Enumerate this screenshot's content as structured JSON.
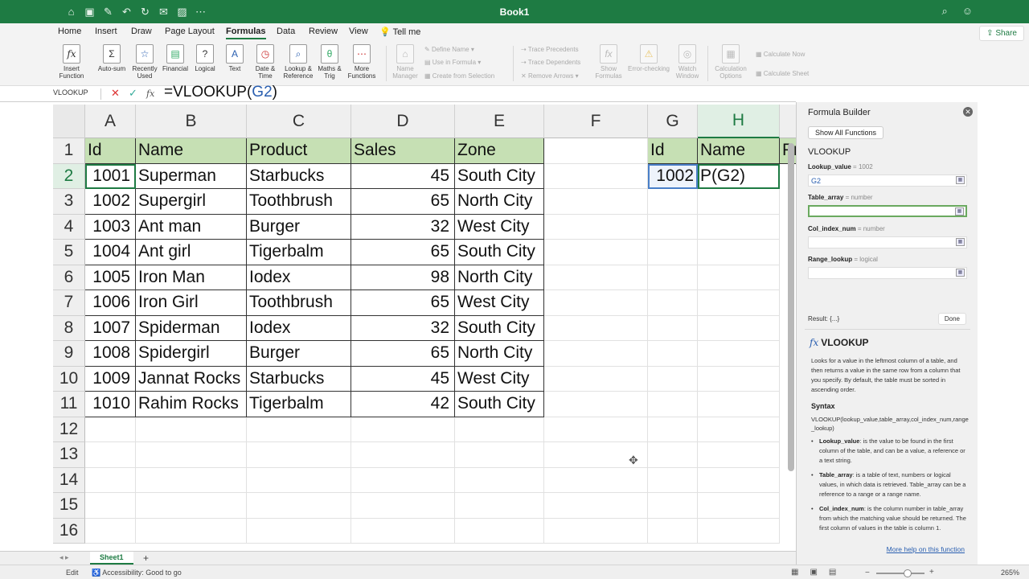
{
  "window": {
    "title": "Book1"
  },
  "quick_access": [
    "home-icon",
    "save-icon",
    "edit-icon",
    "undo-icon",
    "redo-icon",
    "mail-icon",
    "image-icon",
    "more-icon"
  ],
  "tabs": [
    "Home",
    "Insert",
    "Draw",
    "Page Layout",
    "Formulas",
    "Data",
    "Review",
    "View",
    "Tell me"
  ],
  "active_tab": "Formulas",
  "share_label": "Share",
  "ribbon": {
    "insert_function": "Insert Function",
    "autosum": "Auto-sum",
    "recently_used": "Recently Used",
    "financial": "Financial",
    "logical": "Logical",
    "text": "Text",
    "date_time": "Date & Time",
    "lookup": "Lookup & Reference",
    "maths": "Maths & Trig",
    "more_functions": "More Functions",
    "name_manager": "Name Manager",
    "define_name": "Define Name",
    "use_in_formula": "Use in Formula",
    "create_from_selection": "Create from Selection",
    "trace_precedents": "Trace Precedents",
    "trace_dependents": "Trace Dependents",
    "remove_arrows": "Remove Arrows",
    "show_formulas": "Show Formulas",
    "error_checking": "Error-checking",
    "watch_window": "Watch Window",
    "calc_options": "Calculation Options",
    "calc_now": "Calculate Now",
    "calc_sheet": "Calculate Sheet"
  },
  "formula_bar": {
    "name_box": "VLOOKUP",
    "formula_prefix": "=VLOOKUP(",
    "formula_ref": "G2",
    "formula_suffix": ")"
  },
  "columns": [
    "A",
    "B",
    "C",
    "D",
    "E",
    "F",
    "G",
    "H"
  ],
  "rows": [
    "1",
    "2",
    "3",
    "4",
    "5",
    "6",
    "7",
    "8",
    "9",
    "10",
    "11",
    "12",
    "13",
    "14",
    "15",
    "16"
  ],
  "table": {
    "headers": [
      "Id",
      "Name",
      "Product",
      "Sales",
      "Zone"
    ],
    "rows": [
      [
        "1001",
        "Superman",
        "Starbucks",
        "45",
        "South City"
      ],
      [
        "1002",
        "Supergirl",
        "Toothbrush",
        "65",
        "North City"
      ],
      [
        "1003",
        "Ant man",
        "Burger",
        "32",
        "West City"
      ],
      [
        "1004",
        "Ant girl",
        "Tigerbalm",
        "65",
        "South City"
      ],
      [
        "1005",
        "Iron Man",
        "Iodex",
        "98",
        "North City"
      ],
      [
        "1006",
        "Iron Girl",
        "Toothbrush",
        "65",
        "West City"
      ],
      [
        "1007",
        "Spiderman",
        "Iodex",
        "32",
        "South City"
      ],
      [
        "1008",
        "Spidergirl",
        "Burger",
        "65",
        "North City"
      ],
      [
        "1009",
        "Jannat Rocks",
        "Starbucks",
        "45",
        "West City"
      ],
      [
        "1010",
        "Rahim Rocks",
        "Tigerbalm",
        "42",
        "South City"
      ]
    ]
  },
  "lookup": {
    "headers": [
      "Id",
      "Name",
      "Pr"
    ],
    "id_value": "1002",
    "name_value": "P(G2)"
  },
  "formula_builder": {
    "title": "Formula Builder",
    "show_all": "Show All Functions",
    "function": "VLOOKUP",
    "args": [
      {
        "name": "Lookup_value",
        "hint": "1002",
        "value": "G2"
      },
      {
        "name": "Table_array",
        "hint": "number",
        "value": ""
      },
      {
        "name": "Col_index_num",
        "hint": "number",
        "value": ""
      },
      {
        "name": "Range_lookup",
        "hint": "logical",
        "value": ""
      }
    ],
    "result": "Result: {...}",
    "done": "Done",
    "help_title": "VLOOKUP",
    "help_desc": "Looks for a value in the leftmost column of a table, and then returns a value in the same row from a column that you specify. By default, the table must be sorted in ascending order.",
    "syntax_heading": "Syntax",
    "syntax": "VLOOKUP(lookup_value,table_array,col_index_num,range_lookup)",
    "bullets": [
      {
        "term": "Lookup_value",
        "text": ": is the value to be found in the first column of the table, and can be a value, a reference or a text string."
      },
      {
        "term": "Table_array",
        "text": ": is a table of text, numbers or logical values, in which data is retrieved. Table_array can be a reference to a range or a range name."
      },
      {
        "term": "Col_index_num",
        "text": ": is the column number in table_array from which the matching value should be returned. The first column of values in the table is column 1."
      }
    ],
    "more_help": "More help on this function"
  },
  "sheets": [
    "Sheet1"
  ],
  "status": {
    "mode": "Edit",
    "accessibility": "Accessibility: Good to go",
    "zoom": "265%"
  }
}
